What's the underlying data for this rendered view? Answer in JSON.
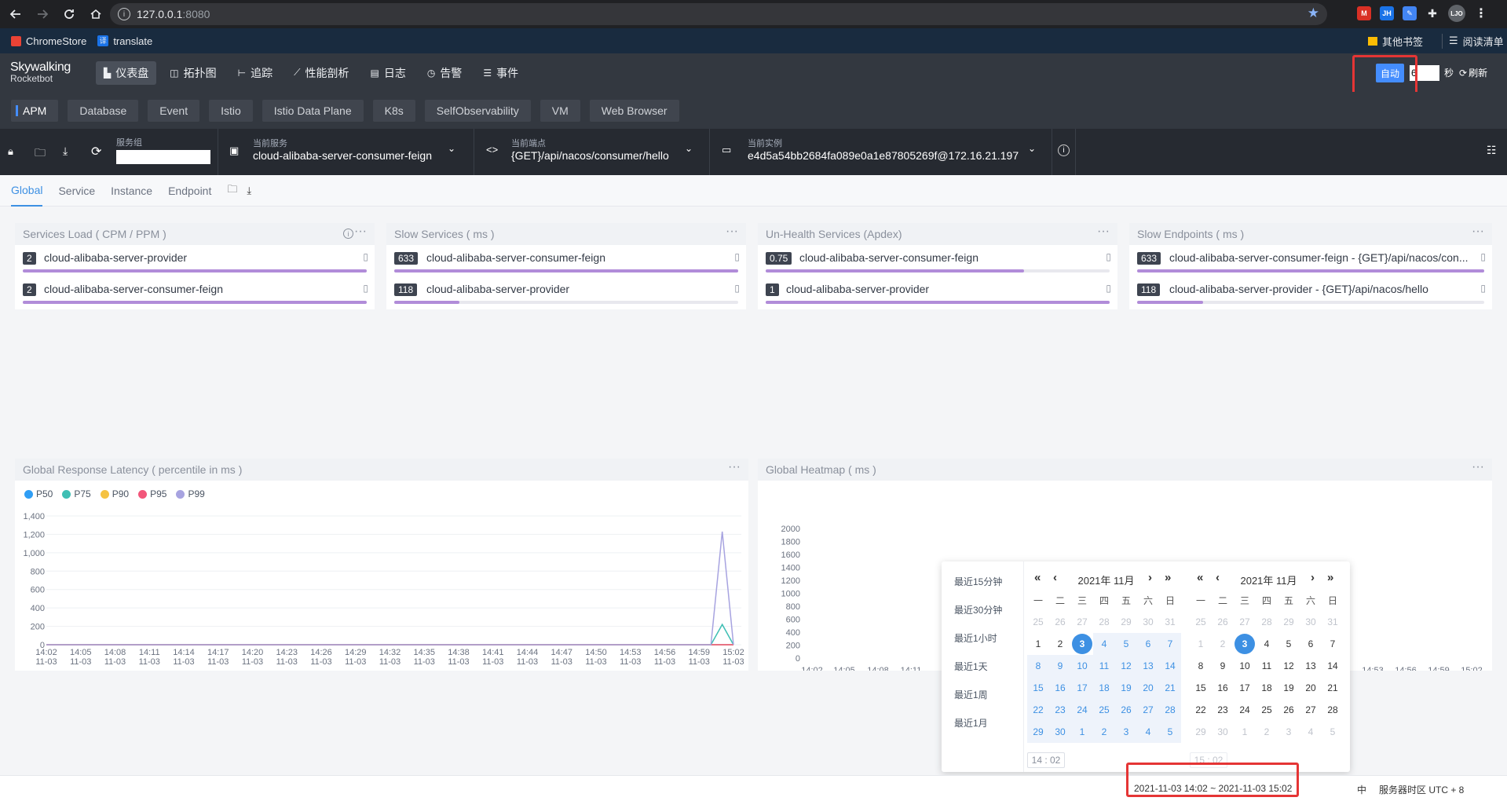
{
  "browser": {
    "url_host": "127.0.0.1",
    "url_port": ":8080",
    "bookmarks": [
      "ChromeStore",
      "translate"
    ],
    "other_bookmarks": "其他书签",
    "reading_list": "阅读清单",
    "extensions": [
      "M",
      "JH",
      "",
      "",
      "LJO"
    ]
  },
  "app": {
    "logo_line1": "Skywalking",
    "logo_line2": "Rocketbot",
    "nav": [
      {
        "label": "仪表盘",
        "icon": "dashboard-icon"
      },
      {
        "label": "拓扑图",
        "icon": "topology-icon"
      },
      {
        "label": "追踪",
        "icon": "trace-icon"
      },
      {
        "label": "性能剖析",
        "icon": "profile-icon"
      },
      {
        "label": "日志",
        "icon": "log-icon"
      },
      {
        "label": "告警",
        "icon": "alarm-icon"
      },
      {
        "label": "事件",
        "icon": "event-icon"
      }
    ],
    "auto_label": "自动",
    "seconds_value": "6",
    "seconds_unit": "秒",
    "refresh_label": "刷新"
  },
  "layer_tabs": [
    "APM",
    "Database",
    "Event",
    "Istio",
    "Istio Data Plane",
    "K8s",
    "SelfObservability",
    "VM",
    "Web Browser"
  ],
  "selectors": {
    "group_label": "服务组",
    "group_value": "",
    "service_label": "当前服务",
    "service_value": "cloud-alibaba-server-consumer-feign",
    "endpoint_label": "当前端点",
    "endpoint_value": "{GET}/api/nacos/consumer/hello",
    "instance_label": "当前实例",
    "instance_value": "e4d5a54bb2684fa089e0a1e87805269f@172.16.21.197"
  },
  "sub_tabs": [
    "Global",
    "Service",
    "Instance",
    "Endpoint"
  ],
  "panels": {
    "services_load": {
      "title": "Services Load ( CPM / PPM )",
      "rows": [
        {
          "value": "2",
          "name": "cloud-alibaba-server-provider",
          "ratio": 1.0
        },
        {
          "value": "2",
          "name": "cloud-alibaba-server-consumer-feign",
          "ratio": 1.0
        }
      ]
    },
    "slow_services": {
      "title": "Slow Services ( ms )",
      "rows": [
        {
          "value": "633",
          "name": "cloud-alibaba-server-consumer-feign",
          "ratio": 1.0
        },
        {
          "value": "118",
          "name": "cloud-alibaba-server-provider",
          "ratio": 0.19
        }
      ]
    },
    "unhealth": {
      "title": "Un-Health Services (Apdex)",
      "rows": [
        {
          "value": "0.75",
          "name": "cloud-alibaba-server-consumer-feign",
          "ratio": 0.75
        },
        {
          "value": "1",
          "name": "cloud-alibaba-server-provider",
          "ratio": 1.0
        }
      ]
    },
    "slow_endpoints": {
      "title": "Slow Endpoints ( ms )",
      "rows": [
        {
          "value": "633",
          "name": "cloud-alibaba-server-consumer-feign - {GET}/api/nacos/con...",
          "ratio": 1.0
        },
        {
          "value": "118",
          "name": "cloud-alibaba-server-provider - {GET}/api/nacos/hello",
          "ratio": 0.19
        }
      ]
    },
    "latency_title": "Global Response Latency ( percentile in ms )",
    "heatmap_title": "Global Heatmap ( ms )"
  },
  "chart_data": [
    {
      "type": "line",
      "title": "Global Response Latency ( percentile in ms )",
      "x": [
        "14:02\n11-03",
        "14:05\n11-03",
        "14:08\n11-03",
        "14:11\n11-03",
        "14:14\n11-03",
        "14:17\n11-03",
        "14:20\n11-03",
        "14:23\n11-03",
        "14:26\n11-03",
        "14:29\n11-03",
        "14:32\n11-03",
        "14:35\n11-03",
        "14:38\n11-03",
        "14:41\n11-03",
        "14:44\n11-03",
        "14:47\n11-03",
        "14:50\n11-03",
        "14:53\n11-03",
        "14:56\n11-03",
        "14:59\n11-03",
        "15:02\n11-03"
      ],
      "ylim": [
        0,
        1400
      ],
      "yticks": [
        0,
        200,
        400,
        600,
        800,
        1000,
        1200,
        1400
      ],
      "ytick_labels": [
        "0",
        "200",
        "400",
        "600",
        "800",
        "1,000",
        "1,200",
        "1,400"
      ],
      "series": [
        {
          "name": "P50",
          "color": "#2f9ef5",
          "spike": 0
        },
        {
          "name": "P75",
          "color": "#3fbfb4",
          "spike": 220
        },
        {
          "name": "P90",
          "color": "#f5c242",
          "spike": 0
        },
        {
          "name": "P95",
          "color": "#f2567a",
          "spike": 0
        },
        {
          "name": "P99",
          "color": "#a7a3e0",
          "spike": 1230
        }
      ],
      "spike_index": 60,
      "points": 62
    },
    {
      "type": "heatmap",
      "title": "Global Heatmap ( ms )",
      "ylim": [
        0,
        2000
      ],
      "ytick_labels": [
        "0",
        "200",
        "400",
        "600",
        "800",
        "1000",
        "1200",
        "1400",
        "1600",
        "1800",
        "2000"
      ],
      "x_visible": [
        "14:02\n11-03",
        "14:05\n11-03",
        "14:08\n11-03",
        "14:11\n11-03",
        "14:53\n11-03",
        "14:56\n11-03",
        "14:59\n11-03",
        "15:02\n11-03"
      ]
    }
  ],
  "datepicker": {
    "shortcuts": [
      "最近15分钟",
      "最近30分钟",
      "最近1小时",
      "最近1天",
      "最近1周",
      "最近1月"
    ],
    "month_title": "2021年 11月",
    "weekdays": [
      "一",
      "二",
      "三",
      "四",
      "五",
      "六",
      "日"
    ],
    "left_days": [
      "25",
      "26",
      "27",
      "28",
      "29",
      "30",
      "31",
      "1",
      "2",
      "3",
      "4",
      "5",
      "6",
      "7",
      "8",
      "9",
      "10",
      "11",
      "12",
      "13",
      "14",
      "15",
      "16",
      "17",
      "18",
      "19",
      "20",
      "21",
      "22",
      "23",
      "24",
      "25",
      "26",
      "27",
      "28",
      "29",
      "30",
      "1",
      "2",
      "3",
      "4",
      "5"
    ],
    "right_days": [
      "25",
      "26",
      "27",
      "28",
      "29",
      "30",
      "31",
      "1",
      "2",
      "3",
      "4",
      "5",
      "6",
      "7",
      "8",
      "9",
      "10",
      "11",
      "12",
      "13",
      "14",
      "15",
      "16",
      "17",
      "18",
      "19",
      "20",
      "21",
      "22",
      "23",
      "24",
      "25",
      "26",
      "27",
      "28",
      "29",
      "30",
      "1",
      "2",
      "3",
      "4",
      "5"
    ],
    "start_time": "14 : 02",
    "end_time": "15 : 02"
  },
  "footer": {
    "range": "2021-11-03 14:02 ~ 2021-11-03 15:02",
    "lang": "中",
    "timezone": "服务器时区 UTC + 8"
  }
}
